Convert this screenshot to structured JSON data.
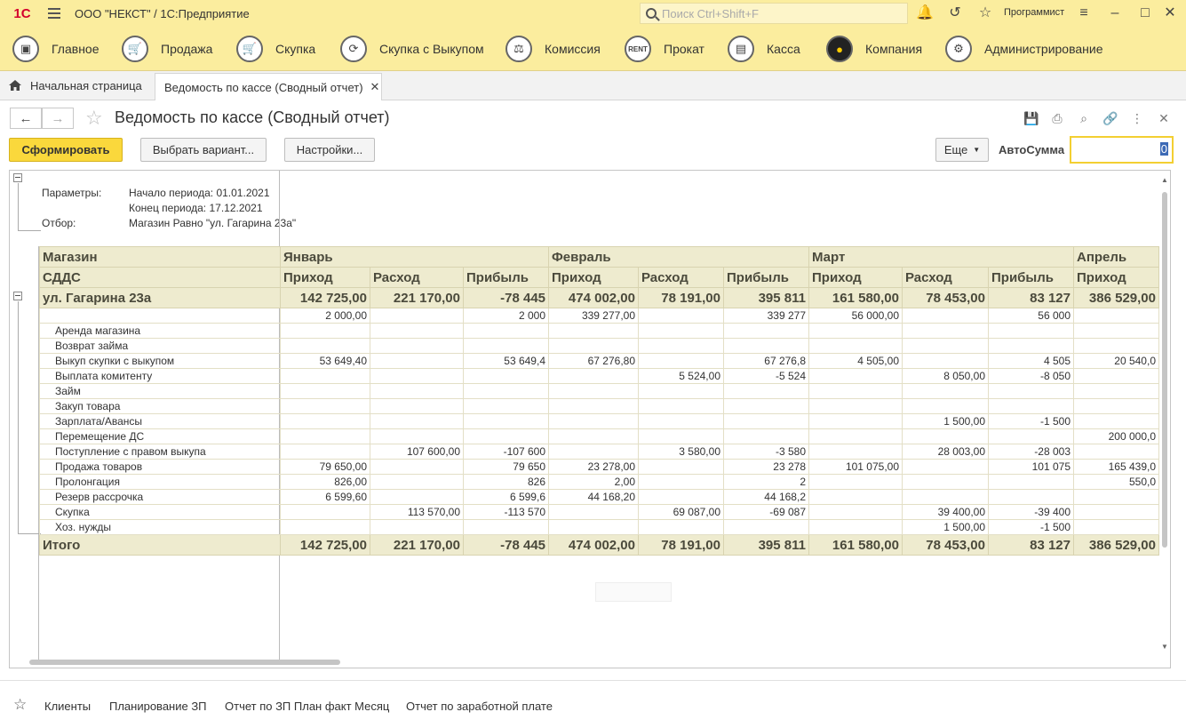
{
  "app": {
    "logo": "1С",
    "title": "ООО \"НЕКСТ\" /  1С:Предприятие",
    "search_placeholder": "Поиск Ctrl+Shift+F",
    "user": "Программист"
  },
  "sections": [
    {
      "label": "Главное",
      "icon": "computer-icon"
    },
    {
      "label": "Продажа",
      "icon": "cart-icon"
    },
    {
      "label": "Скупка",
      "icon": "cart-icon"
    },
    {
      "label": "Скупка с Выкупом",
      "icon": "cycle-icon"
    },
    {
      "label": "Комиссия",
      "icon": "scales-icon"
    },
    {
      "label": "Прокат",
      "icon": "rent-icon"
    },
    {
      "label": "Касса",
      "icon": "register-icon"
    },
    {
      "label": "Компания",
      "icon": "company-icon"
    },
    {
      "label": "Администрирование",
      "icon": "gears-icon"
    }
  ],
  "tabs": {
    "home": "Начальная страница",
    "active": "Ведомость по кассе (Сводный отчет)"
  },
  "form": {
    "title": "Ведомость по кассе (Сводный отчет)",
    "generate": "Сформировать",
    "choose_variant": "Выбрать вариант...",
    "settings": "Настройки...",
    "more": "Еще",
    "autosum_label": "АвтоСумма",
    "autosum_value": "0"
  },
  "params": {
    "label_params": "Параметры:",
    "period_start": "Начало периода: 01.01.2021",
    "period_end": "Конец периода: 17.12.2021",
    "label_filter": "Отбор:",
    "filter": "Магазин Равно \"ул. Гагарина 23а\""
  },
  "table": {
    "h1_left": "Магазин",
    "h2_left": "СДДС",
    "months": [
      "Январь",
      "Февраль",
      "Март",
      "Апрель"
    ],
    "subcols": [
      "Приход",
      "Расход",
      "Прибыль",
      "Приход",
      "Расход",
      "Прибыль",
      "Приход",
      "Расход",
      "Прибыль",
      "Приход"
    ],
    "group": {
      "name": "ул. Гагарина 23а",
      "values": [
        "142 725,00",
        "221 170,00",
        "-78 445",
        "474 002,00",
        "78 191,00",
        "395 811",
        "161 580,00",
        "78 453,00",
        "83 127",
        "386 529,00"
      ]
    },
    "rows": [
      {
        "name": "",
        "values": [
          "2 000,00",
          "",
          "2 000",
          "339 277,00",
          "",
          "339 277",
          "56 000,00",
          "",
          "56 000",
          ""
        ]
      },
      {
        "name": "Аренда магазина",
        "values": [
          "",
          "",
          "",
          "",
          "",
          "",
          "",
          "",
          "",
          ""
        ]
      },
      {
        "name": "Возврат займа",
        "values": [
          "",
          "",
          "",
          "",
          "",
          "",
          "",
          "",
          "",
          ""
        ]
      },
      {
        "name": "Выкуп скупки с выкупом",
        "values": [
          "53 649,40",
          "",
          "53 649,4",
          "67 276,80",
          "",
          "67 276,8",
          "4 505,00",
          "",
          "4 505",
          "20 540,0"
        ]
      },
      {
        "name": "Выплата комитенту",
        "values": [
          "",
          "",
          "",
          "",
          "5 524,00",
          "-5 524",
          "",
          "8 050,00",
          "-8 050",
          ""
        ]
      },
      {
        "name": "Займ",
        "values": [
          "",
          "",
          "",
          "",
          "",
          "",
          "",
          "",
          "",
          ""
        ]
      },
      {
        "name": "Закуп товара",
        "values": [
          "",
          "",
          "",
          "",
          "",
          "",
          "",
          "",
          "",
          ""
        ]
      },
      {
        "name": "Зарплата/Авансы",
        "values": [
          "",
          "",
          "",
          "",
          "",
          "",
          "",
          "1 500,00",
          "-1 500",
          ""
        ]
      },
      {
        "name": "Перемещение ДС",
        "values": [
          "",
          "",
          "",
          "",
          "",
          "",
          "",
          "",
          "",
          "200 000,0"
        ]
      },
      {
        "name": "Поступление с правом выкупа",
        "values": [
          "",
          "107 600,00",
          "-107 600",
          "",
          "3 580,00",
          "-3 580",
          "",
          "28 003,00",
          "-28 003",
          ""
        ]
      },
      {
        "name": "Продажа товаров",
        "values": [
          "79 650,00",
          "",
          "79 650",
          "23 278,00",
          "",
          "23 278",
          "101 075,00",
          "",
          "101 075",
          "165 439,0"
        ]
      },
      {
        "name": "Пролонгация",
        "values": [
          "826,00",
          "",
          "826",
          "2,00",
          "",
          "2",
          "",
          "",
          "",
          "550,0"
        ]
      },
      {
        "name": "Резерв рассрочка",
        "values": [
          "6 599,60",
          "",
          "6 599,6",
          "44 168,20",
          "",
          "44 168,2",
          "",
          "",
          "",
          ""
        ]
      },
      {
        "name": "Скупка",
        "values": [
          "",
          "113 570,00",
          "-113 570",
          "",
          "69 087,00",
          "-69 087",
          "",
          "39 400,00",
          "-39 400",
          ""
        ]
      },
      {
        "name": "Хоз. нужды",
        "values": [
          "",
          "",
          "",
          "",
          "",
          "",
          "",
          "1 500,00",
          "-1 500",
          ""
        ]
      }
    ],
    "total": {
      "name": "Итого",
      "values": [
        "142 725,00",
        "221 170,00",
        "-78 445",
        "474 002,00",
        "78 191,00",
        "395 811",
        "161 580,00",
        "78 453,00",
        "83 127",
        "386 529,00"
      ]
    }
  },
  "footer": {
    "links": [
      "Клиенты",
      "Планирование ЗП",
      "Отчет по ЗП План факт Месяц",
      "Отчет по заработной плате"
    ]
  }
}
